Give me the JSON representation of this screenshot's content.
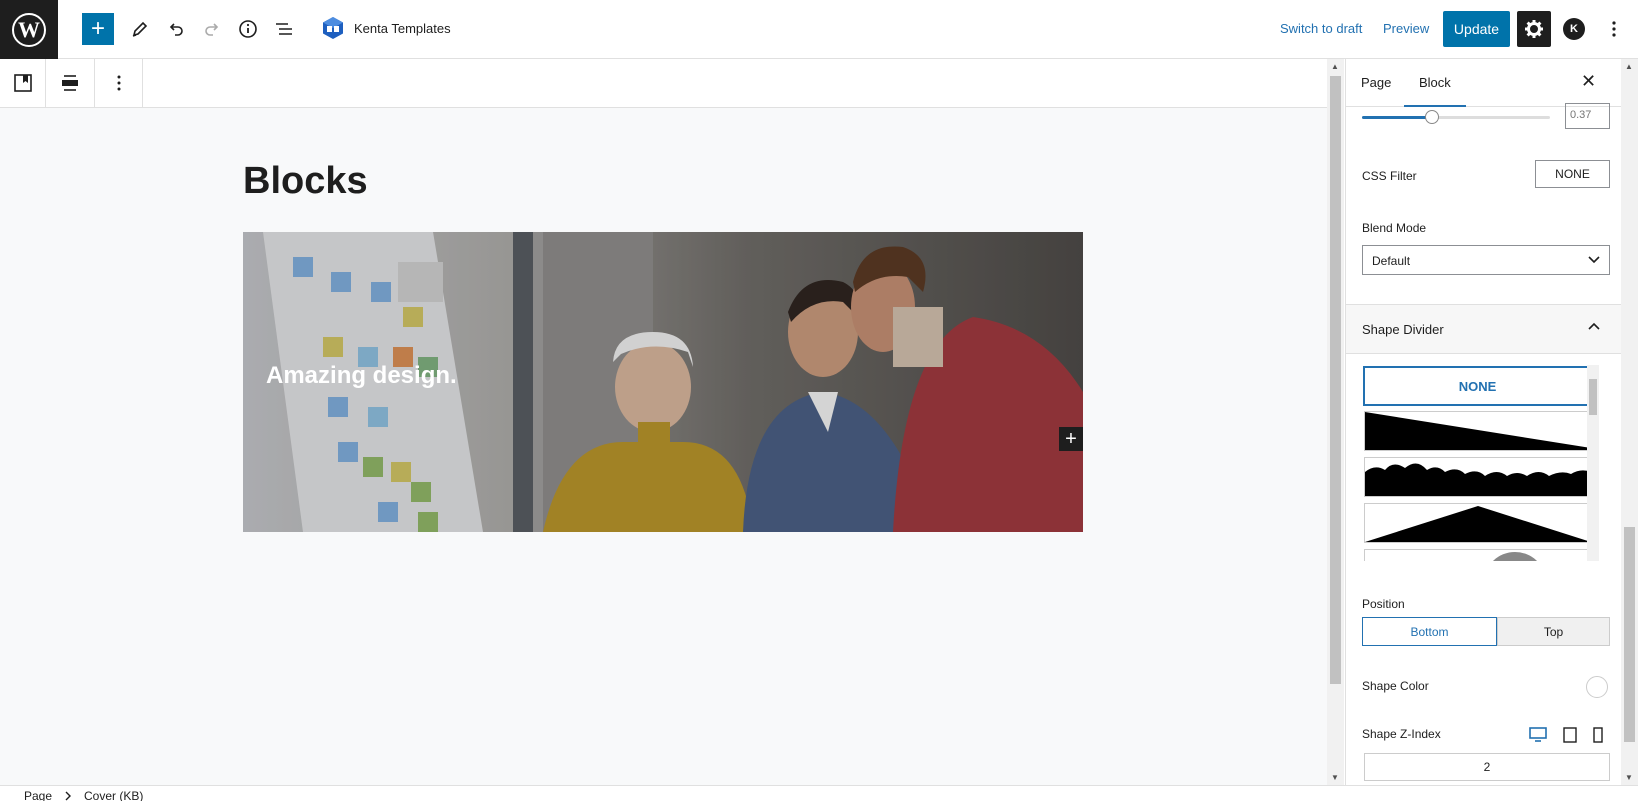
{
  "header": {
    "site_name": "Kenta Templates",
    "switch_to_draft": "Switch to draft",
    "preview": "Preview",
    "update": "Update",
    "avatar_letter": "K",
    "icons": [
      "wordpress-icon",
      "plus-icon",
      "pencil-icon",
      "undo-icon",
      "redo-icon",
      "info-icon",
      "list-view-icon",
      "kadence-blocks-icon",
      "gear-icon",
      "more-vertical-icon"
    ]
  },
  "canvas": {
    "title": "Blocks",
    "cover": {
      "heading": "Amazing design."
    }
  },
  "sidebar": {
    "tabs": [
      {
        "label": "Page",
        "active": false
      },
      {
        "label": "Block",
        "active": true
      }
    ],
    "opacity_value": "0.37",
    "css_filter": {
      "label": "CSS Filter",
      "value": "NONE"
    },
    "blend_mode": {
      "label": "Blend Mode",
      "value": "Default"
    },
    "shape_divider": {
      "title": "Shape Divider",
      "none_label": "NONE",
      "options": [
        "slant",
        "clouds",
        "triangle"
      ]
    },
    "position": {
      "label": "Position",
      "options": [
        "Bottom",
        "Top"
      ],
      "selected": "Bottom"
    },
    "shape_color": {
      "label": "Shape Color"
    },
    "shape_z_index": {
      "label": "Shape Z-Index",
      "value": "2"
    }
  },
  "footer": {
    "breadcrumb": [
      "Page",
      "Cover (KB)"
    ]
  },
  "colors": {
    "accent": "#0073aa",
    "link": "#2271b1",
    "dark": "#1e1e1e"
  }
}
